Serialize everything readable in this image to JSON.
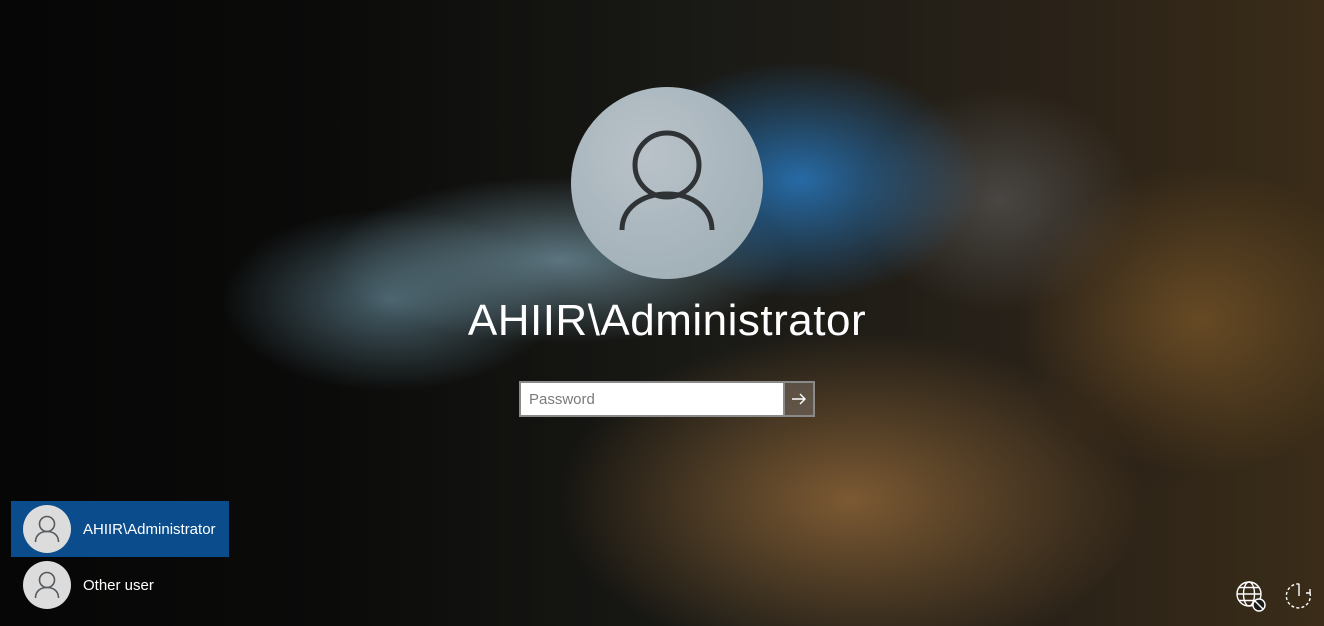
{
  "login": {
    "username": "AHIIR\\Administrator",
    "password_placeholder": "Password",
    "password_value": ""
  },
  "user_list": [
    {
      "label": "AHIIR\\Administrator",
      "selected": true,
      "icon": "user-avatar-icon"
    },
    {
      "label": "Other user",
      "selected": false,
      "icon": "user-avatar-icon"
    }
  ],
  "tray": {
    "network_icon": "network-disconnected-icon",
    "power_icon": "power-icon"
  },
  "colors": {
    "selected_user_bg": "#0a4c8c",
    "avatar_bg": "#a4b2ba"
  }
}
